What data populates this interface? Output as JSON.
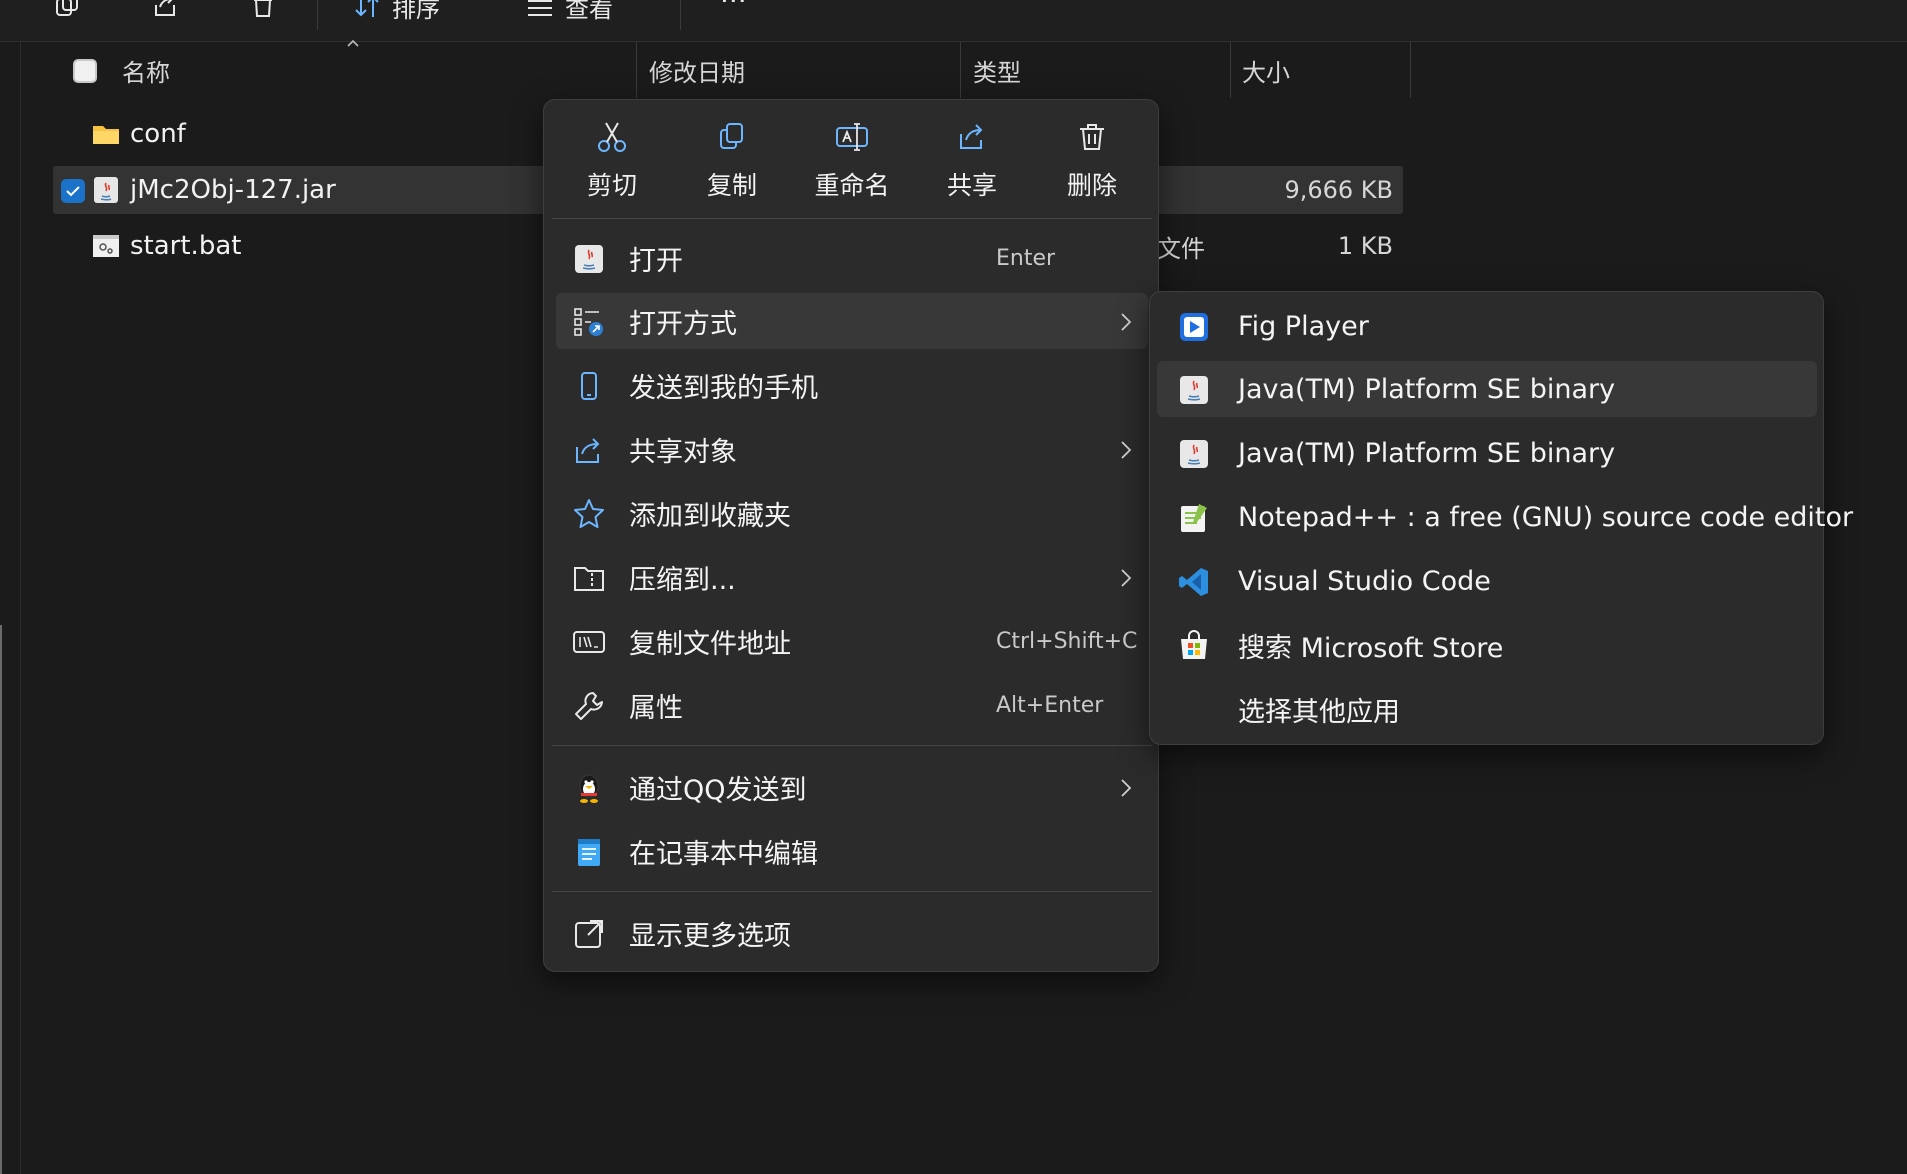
{
  "toolbar": {
    "sort_label": "排序",
    "view_label": "查看",
    "more_label": "···"
  },
  "columns": {
    "name": "名称",
    "modified": "修改日期",
    "type": "类型",
    "size": "大小"
  },
  "files": [
    {
      "name": "conf",
      "type": "",
      "size": "",
      "icon": "folder-icon",
      "selected": false
    },
    {
      "name": "jMc2Obj-127.jar",
      "type": "",
      "size": "9,666 KB",
      "icon": "java-jar-icon",
      "selected": true
    },
    {
      "name": "start.bat",
      "type": "文件",
      "size": "1 KB",
      "icon": "batch-file-icon",
      "selected": false
    }
  ],
  "context_menu": {
    "quick_actions": [
      {
        "label": "剪切",
        "icon": "scissors-icon"
      },
      {
        "label": "复制",
        "icon": "copy-icon"
      },
      {
        "label": "重命名",
        "icon": "rename-icon"
      },
      {
        "label": "共享",
        "icon": "share-icon"
      },
      {
        "label": "删除",
        "icon": "trash-icon"
      }
    ],
    "items": [
      {
        "label": "打开",
        "shortcut": "Enter",
        "icon": "java-icon"
      },
      {
        "label": "打开方式",
        "shortcut": "",
        "icon": "open-with-icon",
        "submenu": true
      },
      {
        "label": "发送到我的手机",
        "shortcut": "",
        "icon": "phone-icon"
      },
      {
        "label": "共享对象",
        "shortcut": "",
        "icon": "share-icon",
        "submenu": true
      },
      {
        "label": "添加到收藏夹",
        "shortcut": "",
        "icon": "star-icon"
      },
      {
        "label": "压缩到...",
        "shortcut": "",
        "icon": "zip-folder-icon",
        "submenu": true
      },
      {
        "label": "复制文件地址",
        "shortcut": "Ctrl+Shift+C",
        "icon": "copy-path-icon"
      },
      {
        "label": "属性",
        "shortcut": "Alt+Enter",
        "icon": "wrench-icon"
      },
      {
        "label": "通过QQ发送到",
        "shortcut": "",
        "icon": "qq-penguin-icon",
        "submenu": true
      },
      {
        "label": "在记事本中编辑",
        "shortcut": "",
        "icon": "notepad-icon"
      },
      {
        "label": "显示更多选项",
        "shortcut": "",
        "icon": "more-options-icon"
      }
    ]
  },
  "open_with_menu": [
    {
      "label": "Fig Player",
      "icon": "fig-player-icon"
    },
    {
      "label": "Java(TM) Platform SE binary",
      "icon": "java-icon"
    },
    {
      "label": "Java(TM) Platform SE binary",
      "icon": "java-icon"
    },
    {
      "label": "Notepad++ : a free (GNU) source code editor",
      "icon": "notepad-plus-plus-icon"
    },
    {
      "label": "Visual Studio Code",
      "icon": "vscode-icon"
    },
    {
      "label": "搜索 Microsoft Store",
      "icon": "microsoft-store-icon"
    },
    {
      "label": "选择其他应用",
      "icon": ""
    }
  ],
  "colors": {
    "background": "#1b1b1b",
    "menu_background": "#2b2b2b",
    "hover": "#383838",
    "accent_blue": "#1a73c8",
    "icon_blue": "#6cb6ff"
  }
}
